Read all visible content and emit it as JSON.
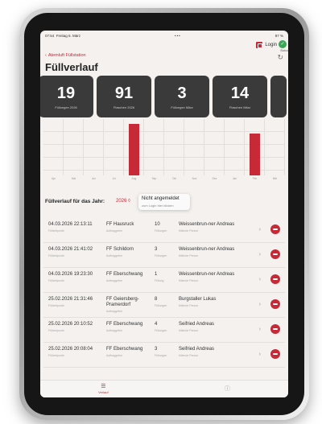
{
  "status_bar": {
    "time": "07:54",
    "date": "Freitag 6. März",
    "dots": "•••",
    "battery": "87 %"
  },
  "header": {
    "back_label": "Atemluft Füllstation",
    "login_label": "Login",
    "status_label": "Status",
    "title": "Füllverlauf"
  },
  "stats": [
    {
      "value": "19",
      "label": "Füllungen 2026"
    },
    {
      "value": "91",
      "label": "Flaschen 2026"
    },
    {
      "value": "3",
      "label": "Füllungen März"
    },
    {
      "value": "14",
      "label": "Flaschen März"
    }
  ],
  "chart_data": {
    "type": "bar",
    "categories": [
      "Apr",
      "Mai",
      "Jun",
      "Jul",
      "Aug",
      "Sep",
      "Okt",
      "Nov",
      "Dez",
      "Jan",
      "Feb",
      "Mär"
    ],
    "values": [
      0,
      0,
      0,
      0,
      91,
      0,
      0,
      0,
      0,
      0,
      74,
      0
    ],
    "ylim": [
      0,
      100
    ],
    "grid": true
  },
  "year_section": {
    "label": "Füllverlauf für das Jahr:",
    "selected_year": "2026 ◊",
    "tooltip_title": "Nicht angemeldet",
    "tooltip_sub": "zum Login hier klicken"
  },
  "rows": [
    {
      "date": "04.03.2026 22:13:11",
      "date_sub": "Füllzeitpunkt",
      "dept": "FF Hausruck",
      "dept_sub": "Auftraggeber",
      "count": "10",
      "count_sub": "Füllungen",
      "person": "Weissenbrun-ner Andreas",
      "person_sub": "füllende Person"
    },
    {
      "date": "04.03.2026 21:41:02",
      "date_sub": "Füllzeitpunkt",
      "dept": "FF Schildorn",
      "dept_sub": "Auftraggeber",
      "count": "3",
      "count_sub": "Füllungen",
      "person": "Weissenbrun-ner Andreas",
      "person_sub": "füllende Person"
    },
    {
      "date": "04.03.2026 19:23:30",
      "date_sub": "Füllzeitpunkt",
      "dept": "FF Eberschwang",
      "dept_sub": "Auftraggeber",
      "count": "1",
      "count_sub": "Füllung",
      "person": "Weissenbrun-ner Andreas",
      "person_sub": "füllende Person"
    },
    {
      "date": "25.02.2026 21:31:46",
      "date_sub": "Füllzeitpunkt",
      "dept": "FF Geiersberg-Pramerdorf",
      "dept_sub": "Auftraggeber",
      "count": "8",
      "count_sub": "Füllungen",
      "person": "Burgstaller Lukas",
      "person_sub": "füllende Person"
    },
    {
      "date": "25.02.2026 20:10:52",
      "date_sub": "Füllzeitpunkt",
      "dept": "FF Eberschwang",
      "dept_sub": "Auftraggeber",
      "count": "4",
      "count_sub": "Füllungen",
      "person": "Seifried Andreas",
      "person_sub": "füllende Person"
    },
    {
      "date": "25.02.2026 20:08:04",
      "date_sub": "Füllzeitpunkt",
      "dept": "FF Eberschwang",
      "dept_sub": "Auftraggeber",
      "count": "3",
      "count_sub": "Füllungen",
      "person": "Seifried Andreas",
      "person_sub": "füllende Person"
    }
  ],
  "tabbar": {
    "tab1_label": "Verlauf",
    "tab2_label": ""
  },
  "colors": {
    "accent": "#c62a36",
    "card": "#3a3a3a",
    "success": "#3aa757"
  }
}
